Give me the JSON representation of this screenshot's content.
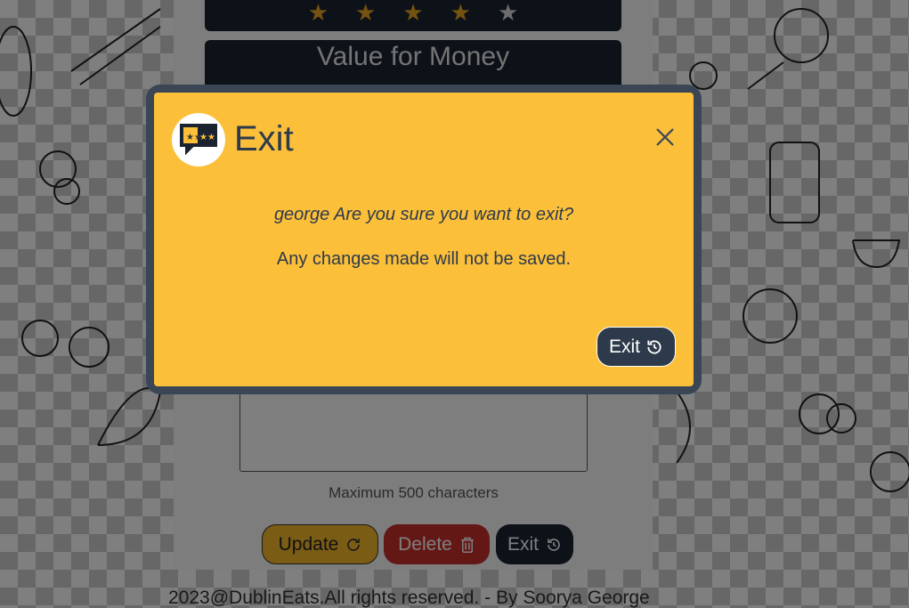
{
  "rating": {
    "stars": [
      {
        "filled": true
      },
      {
        "filled": true
      },
      {
        "filled": true
      },
      {
        "filled": true
      },
      {
        "filled": false
      }
    ],
    "filled_color": "#e9a623",
    "empty_color": "#d9d9d9"
  },
  "section": {
    "title": "Value for Money"
  },
  "review": {
    "max_chars_label": "Maximum 500 characters"
  },
  "actions": {
    "update_label": "Update",
    "delete_label": "Delete",
    "exit_label": "Exit"
  },
  "footer": {
    "text": "2023@DublinEats.All rights reserved. - By Soorya George"
  },
  "modal": {
    "title": "Exit",
    "question": "george Are you sure you want to exit?",
    "note": "Any changes made will not be saved.",
    "exit_button_label": "Exit",
    "icons": {
      "logo": "rating-speech-bubble-icon",
      "close": "close-icon",
      "exit": "restart-icon"
    }
  },
  "colors": {
    "modal_background": "#fbbf3a",
    "modal_border": "#3a4656",
    "primary_dark": "#1b2330",
    "danger": "#c9302c",
    "warning": "#f5b92a"
  }
}
